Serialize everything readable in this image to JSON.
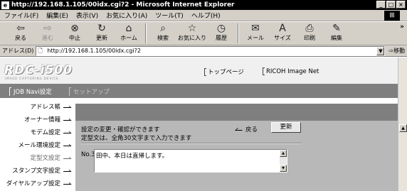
{
  "window": {
    "title": "http://192.168.1.105/00idx.cgi?2 - Microsoft Internet Explorer",
    "minimize": "_",
    "maximize": "□",
    "close": "×"
  },
  "menu": {
    "items": [
      "ファイル(F)",
      "編集(E)",
      "表示(V)",
      "お気に入り(A)",
      "ツール(T)",
      "ヘルプ(H)"
    ]
  },
  "toolbar": {
    "buttons": [
      {
        "label": "戻る",
        "icon": "back-arrow-icon",
        "glyph": "⇦"
      },
      {
        "label": "進む",
        "icon": "forward-arrow-icon",
        "glyph": "⇨"
      },
      {
        "label": "中止",
        "icon": "stop-icon",
        "glyph": "⊗"
      },
      {
        "label": "更新",
        "icon": "refresh-icon",
        "glyph": "↻"
      },
      {
        "label": "ホーム",
        "icon": "home-icon",
        "glyph": "⌂"
      },
      {
        "label": "検索",
        "icon": "search-icon",
        "glyph": "⌕"
      },
      {
        "label": "お気に入り",
        "icon": "favorites-icon",
        "glyph": "☆"
      },
      {
        "label": "履歴",
        "icon": "history-icon",
        "glyph": "◷"
      },
      {
        "label": "メール",
        "icon": "mail-icon",
        "glyph": "✉"
      },
      {
        "label": "サイズ",
        "icon": "font-size-icon",
        "glyph": "A"
      },
      {
        "label": "印刷",
        "icon": "print-icon",
        "glyph": "⎙"
      },
      {
        "label": "編集",
        "icon": "edit-icon",
        "glyph": "✎"
      }
    ],
    "more": "»"
  },
  "address": {
    "label": "アドレス(D)",
    "url": "http://192.168.1.105/00idx.cgi?2",
    "go": "移動"
  },
  "brand": {
    "logo": "RDC-i500",
    "logo_sub": "IMAGE CAPTURING DEVICE",
    "links": [
      "トップページ",
      "RICOH Image Net"
    ]
  },
  "tabs": [
    "JOB Navi設定",
    "セットアップ"
  ],
  "sidebar": {
    "items": [
      "アドレス帳",
      "オーナー情報",
      "モデム設定",
      "メール環境設定",
      "定型文設定",
      "スタンプ文字設定",
      "ダイヤルアップ設定"
    ]
  },
  "main": {
    "message1": "設定の変更・確認ができます",
    "message2": "定型文は、全角30文字まで入力できます",
    "back_label": "戻る",
    "update_label": "更新",
    "no_label": "No.3",
    "text_value": "田中、本日は直帰します。"
  }
}
